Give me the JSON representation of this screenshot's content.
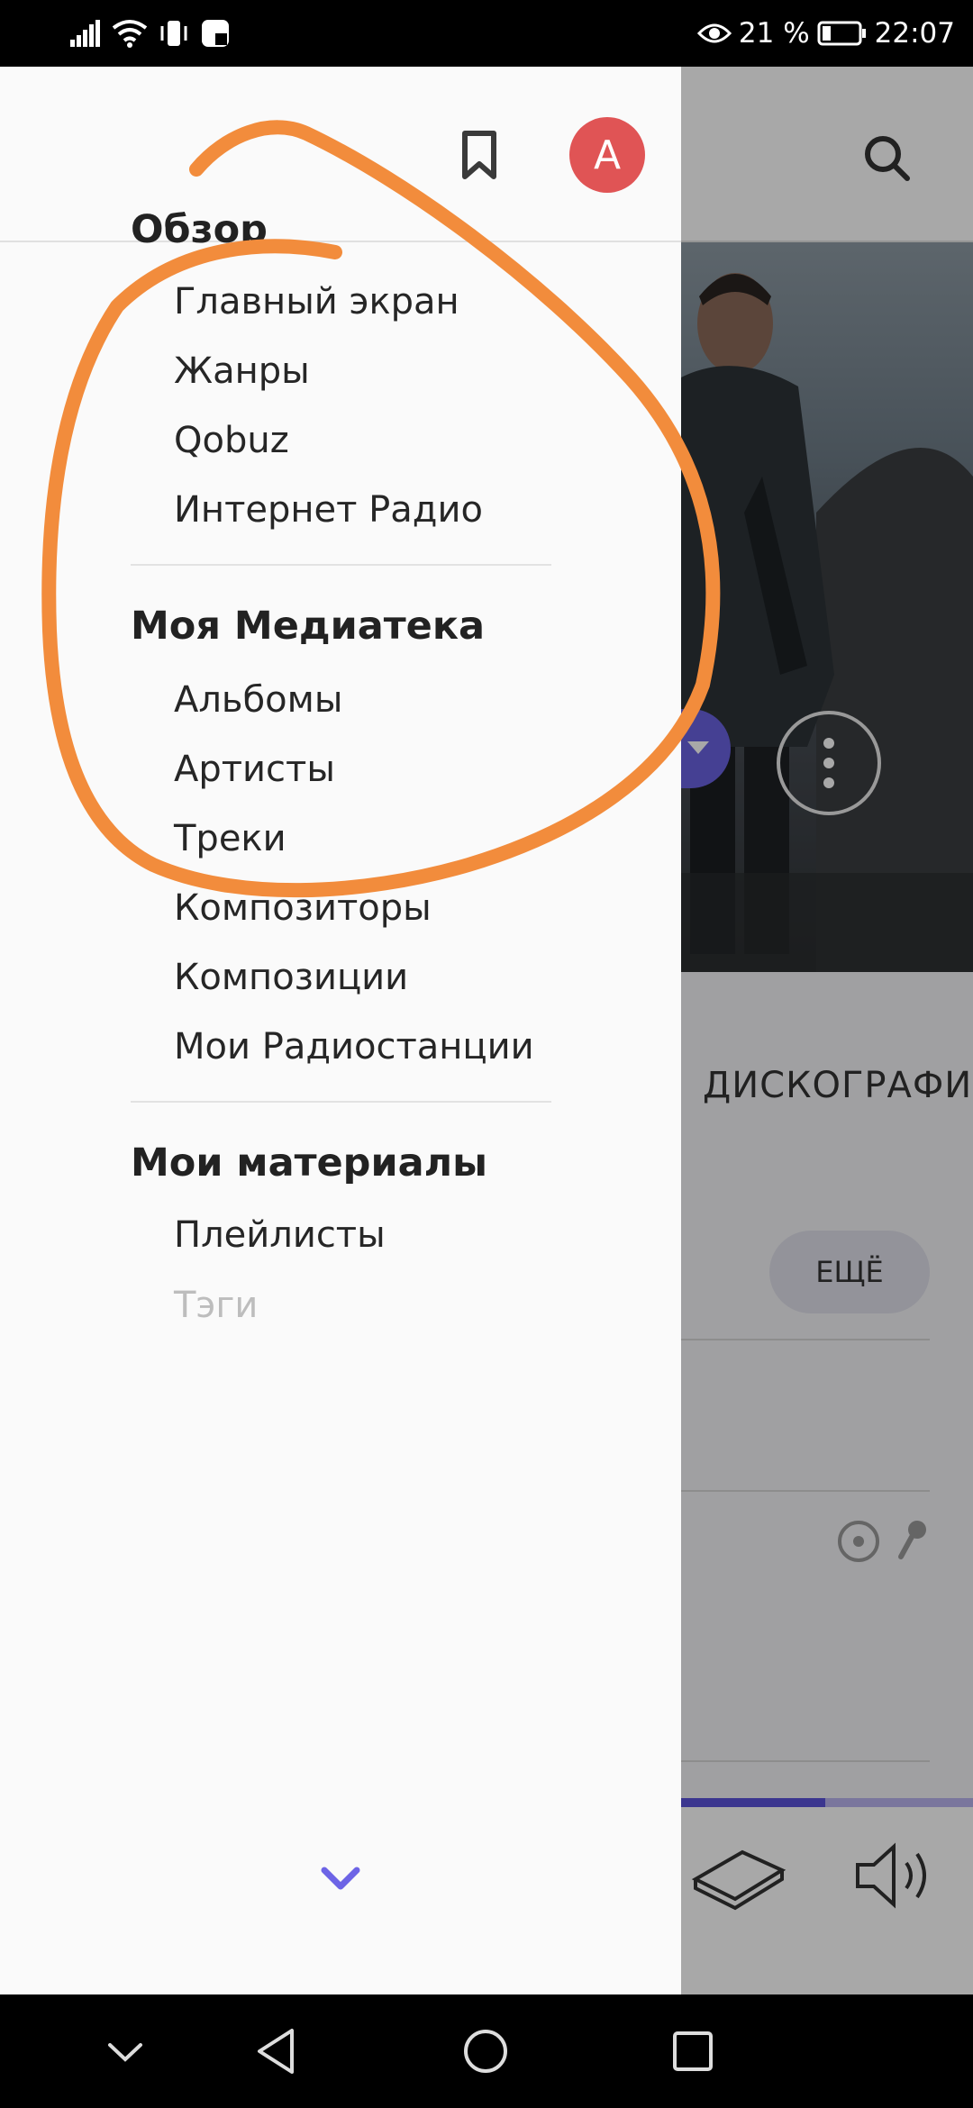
{
  "status_bar": {
    "battery_percent": "21 %",
    "time": "22:07"
  },
  "drawer": {
    "avatar_letter": "A",
    "sections": [
      {
        "title": "Обзор",
        "items": [
          "Главный экран",
          "Жанры",
          "Qobuz",
          "Интернет Радио"
        ]
      },
      {
        "title": "Моя Медиатека",
        "items": [
          "Альбомы",
          "Артисты",
          "Треки",
          "Композиторы",
          "Композиции",
          "Мои Радиостанции"
        ]
      },
      {
        "title": "Мои материалы",
        "items": [
          "Плейлисты",
          "Тэги"
        ]
      }
    ]
  },
  "background": {
    "tab_label": "ДИСКОГРАФИ",
    "more_button": "ЕЩЁ"
  },
  "colors": {
    "accent": "#5a52d9",
    "avatar": "#e05455",
    "annotation": "#f28c3c"
  }
}
